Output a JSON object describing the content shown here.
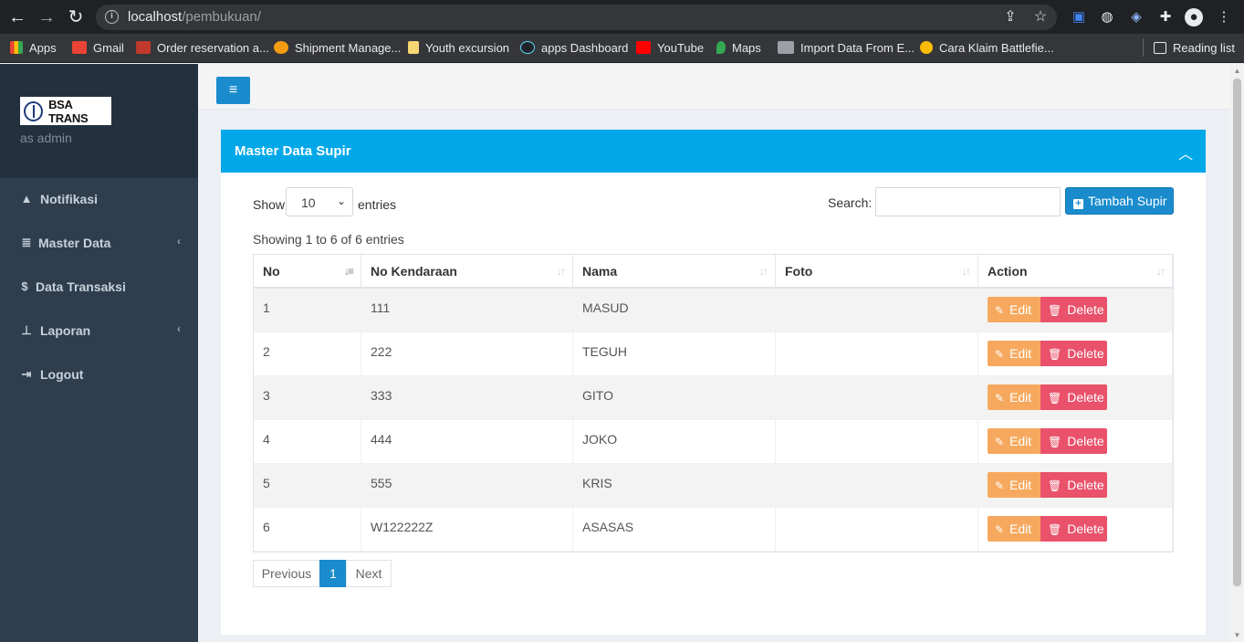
{
  "browser": {
    "url_host": "localhost",
    "url_path": "/pembukuan/",
    "bookmarks": [
      {
        "label": "Apps",
        "color": "#e8453c"
      },
      {
        "label": "Gmail",
        "color": "#ea4335"
      },
      {
        "label": "Order reservation a...",
        "color": "#c0392b"
      },
      {
        "label": "Shipment Manage...",
        "color": "#f39c12"
      },
      {
        "label": "Youth excursion",
        "color": "#f7d774"
      },
      {
        "label": "apps Dashboard",
        "color": "#61dafb"
      },
      {
        "label": "YouTube",
        "color": "#ff0000"
      },
      {
        "label": "Maps",
        "color": "#34a853"
      },
      {
        "label": "Import Data From E...",
        "color": "#9aa0a6"
      },
      {
        "label": "Cara Klaim Battlefie...",
        "color": "#fbbc05"
      }
    ],
    "reading_list": "Reading list"
  },
  "sidebar": {
    "logo_text": "BSA TRANS",
    "role": "as admin",
    "items": [
      {
        "label": "Notifikasi",
        "icon": "bell-icon",
        "glyph": "🔔"
      },
      {
        "label": "Master Data",
        "icon": "database-icon",
        "glyph": "≡"
      },
      {
        "label": "Data Transaksi",
        "icon": "dollar-icon",
        "glyph": "$"
      },
      {
        "label": "Laporan",
        "icon": "sitemap-icon",
        "glyph": "⊥"
      },
      {
        "label": "Logout",
        "icon": "logout-icon",
        "glyph": "⇥"
      }
    ]
  },
  "box": {
    "title": "Master Data Supir"
  },
  "table_controls": {
    "show_label": "Show",
    "entries_label": "entries",
    "length_value": "10",
    "search_label": "Search:",
    "search_value": "",
    "add_button": "Tambah Supir",
    "info": "Showing 1 to 6 of 6 entries"
  },
  "table": {
    "columns": [
      "No",
      "No Kendaraan",
      "Nama",
      "Foto",
      "Action"
    ],
    "rows": [
      {
        "no": "1",
        "kendaraan": "111",
        "nama": "MASUD",
        "foto": ""
      },
      {
        "no": "2",
        "kendaraan": "222",
        "nama": "TEGUH",
        "foto": ""
      },
      {
        "no": "3",
        "kendaraan": "333",
        "nama": "GITO",
        "foto": ""
      },
      {
        "no": "4",
        "kendaraan": "444",
        "nama": "JOKO",
        "foto": ""
      },
      {
        "no": "5",
        "kendaraan": "555",
        "nama": "KRIS",
        "foto": ""
      },
      {
        "no": "6",
        "kendaraan": "W122222Z",
        "nama": "ASASAS",
        "foto": ""
      }
    ],
    "edit_label": "Edit",
    "delete_label": "Delete"
  },
  "pagination": {
    "previous": "Previous",
    "current": "1",
    "next": "Next"
  },
  "colors": {
    "accent": "#00a8e8",
    "primary_button": "#1a8ccd",
    "edit": "#f6a95e",
    "delete": "#e9526a",
    "sidebar": "#2e3e4e"
  }
}
